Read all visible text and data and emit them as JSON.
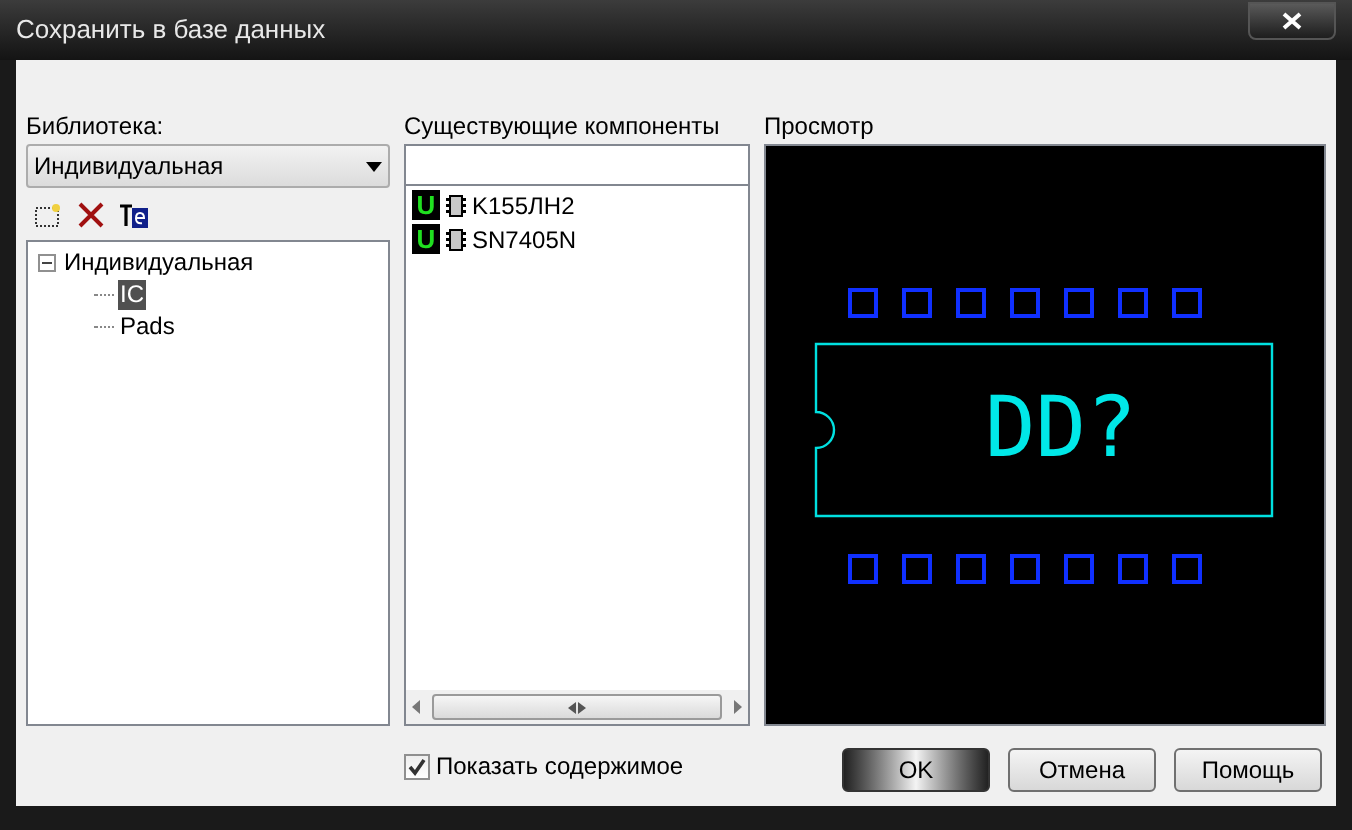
{
  "window": {
    "title": "Сохранить в базе данных"
  },
  "library": {
    "label": "Библиотека:",
    "value": "Индивидуальная"
  },
  "tree": [
    {
      "label": "Индивидуальная",
      "expanded": true,
      "selected": false,
      "children": [
        {
          "label": "IC",
          "selected": true
        },
        {
          "label": "Pads",
          "selected": false
        }
      ]
    }
  ],
  "components": {
    "label": "Существующие компоненты",
    "items": [
      {
        "badge": "U",
        "name": "K155ЛН2"
      },
      {
        "badge": "U",
        "name": "SN7405N"
      }
    ]
  },
  "preview": {
    "label": "Просмотр",
    "designator": "DD?"
  },
  "show_contents": {
    "label": "Показать содержимое",
    "checked": true
  },
  "buttons": [
    {
      "label": "OK",
      "default": true
    },
    {
      "label": "Отмена",
      "default": false
    },
    {
      "label": "Помощь",
      "default": false
    }
  ]
}
